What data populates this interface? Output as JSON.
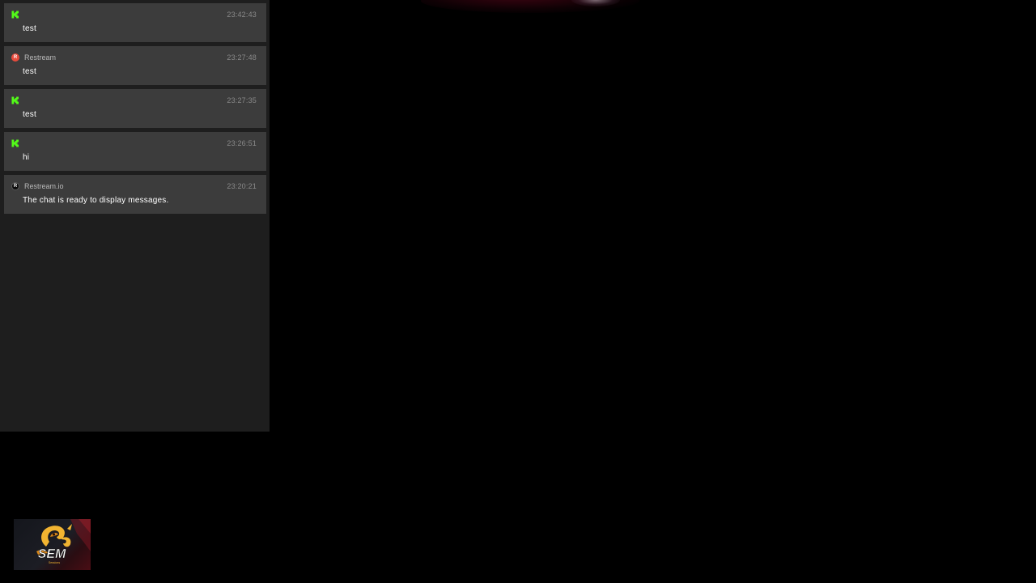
{
  "chat": {
    "messages": [
      {
        "platform": "kick",
        "platform_icon": "kick-icon",
        "author": "",
        "time": "23:42:43",
        "text": "test"
      },
      {
        "platform": "restream",
        "platform_icon": "restream-icon",
        "author": "Restream",
        "time": "23:27:48",
        "text": "test"
      },
      {
        "platform": "kick",
        "platform_icon": "kick-icon",
        "author": "",
        "time": "23:27:35",
        "text": "test"
      },
      {
        "platform": "kick",
        "platform_icon": "kick-icon",
        "author": "",
        "time": "23:26:51",
        "text": "hi"
      },
      {
        "platform": "restream-io",
        "platform_icon": "restream-io-icon",
        "author": "Restream.io",
        "time": "23:20:21",
        "text": "The chat is ready to display messages."
      }
    ]
  },
  "logo": {
    "text": "SEM",
    "subtext": "Sessions"
  },
  "colors": {
    "background": "#000000",
    "chat_panel": "#1e1e1e",
    "message_card": "#3c3c3c",
    "kick_green": "#53fc18",
    "restream_red": "#e84b3c",
    "logo_gold": "#f2b431"
  }
}
